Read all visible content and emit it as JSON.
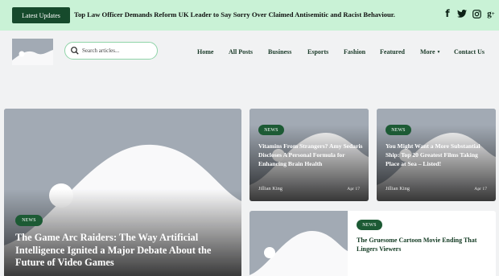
{
  "topbar": {
    "latest_label": "Latest Updates",
    "ticker": "Top Law Officer Demands Reform UK Leader to Say Sorry Over Claimed Antisemitic and Racist Behaviour.",
    "social": [
      "facebook-icon",
      "twitter-icon",
      "instagram-icon",
      "google-plus-icon"
    ]
  },
  "header": {
    "search_placeholder": "Search articles...",
    "nav": [
      "Home",
      "All Posts",
      "Business",
      "Esports",
      "Fashion",
      "Featured",
      "More",
      "Contact Us"
    ]
  },
  "articles": {
    "main": {
      "badge": "NEWS",
      "title": "The Game Arc Raiders: The Way Artificial Intelligence Ignited a Major Debate About the Future of Video Games"
    },
    "side1": {
      "badge": "NEWS",
      "title": "Vitamins From Strangers? Amy Sedaris Discloses A Personal Formula for Enhancing Brain Health",
      "author": "Jillian King",
      "date": "Apr 17"
    },
    "side2": {
      "badge": "NEWS",
      "title": "You Might Want a More Substantial Ship: Top 20 Greatest Films Taking Place at Sea – Listed!",
      "author": "Jillian King",
      "date": "Apr 17"
    },
    "bottom": {
      "badge": "NEWS",
      "title": "The Gruesome Cartoon Movie Ending That Lingers Viewers"
    }
  },
  "colors": {
    "topbar_bg": "#c9f2d6",
    "accent_dark": "#164a2c",
    "badge_bg": "#1c5a34",
    "placeholder": "#a2aab4"
  }
}
